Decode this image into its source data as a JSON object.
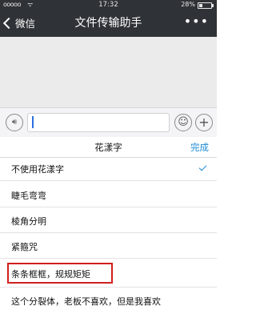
{
  "status_bar": {
    "signal": "ooooo",
    "wifi": "ᯤ",
    "time": "17:32",
    "battery_percent": "28%"
  },
  "nav": {
    "back_label": "微信",
    "title": "文件传输助手",
    "more_label": "•••"
  },
  "input_bar": {
    "voice_icon": "voice-icon",
    "emoji_icon": "emoji-icon",
    "plus_icon": "plus-icon",
    "value": ""
  },
  "picker": {
    "title": "花漾字",
    "done_label": "完成",
    "options": [
      {
        "label": "不使用花漾字",
        "selected": true
      },
      {
        "label": "睫毛弯弯"
      },
      {
        "label": "棱角分明"
      },
      {
        "label": "紧箍咒"
      },
      {
        "label": "条条框框，规规矩矩",
        "highlighted": true
      },
      {
        "label": "这个分裂体，老板不喜欢，但是我喜欢"
      }
    ]
  },
  "colors": {
    "topbar": "#2f3236",
    "accent": "#1a8ad6",
    "highlight_box": "#cf1f1f"
  }
}
